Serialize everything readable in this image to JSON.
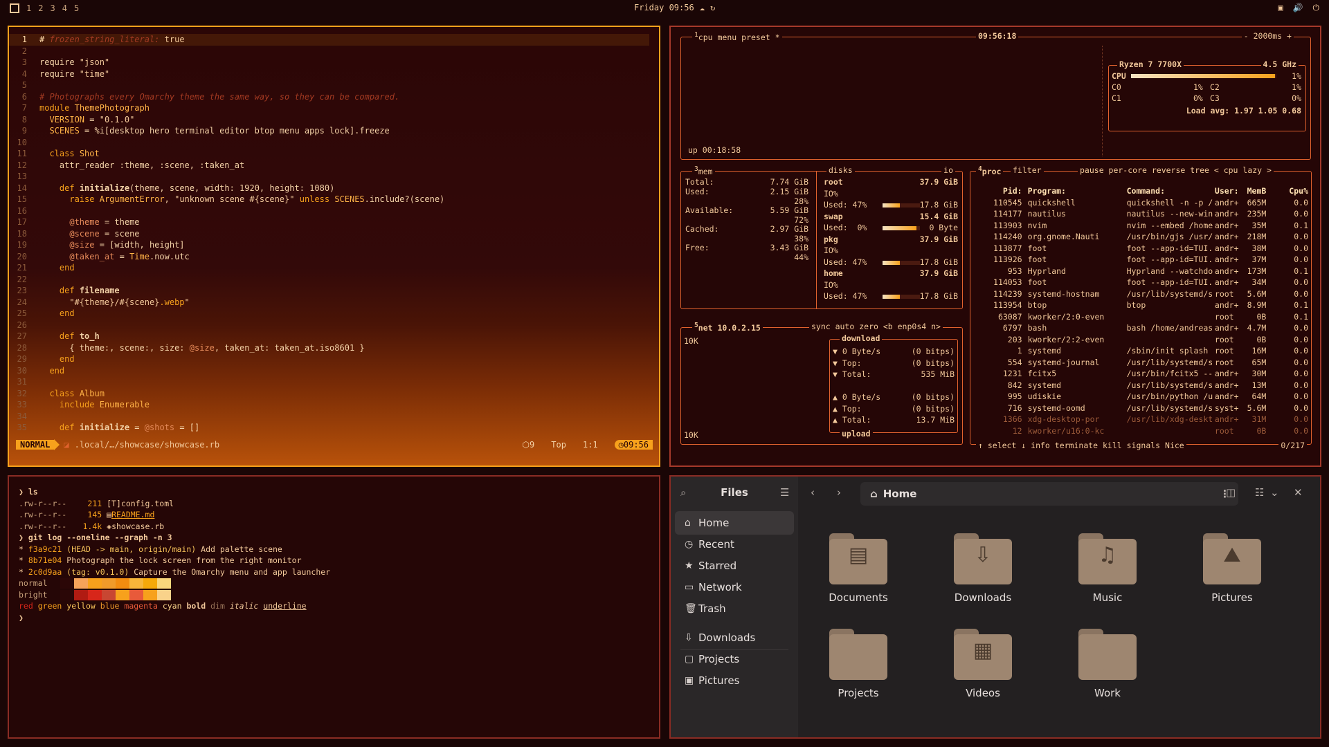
{
  "topbar": {
    "workspaces": [
      "1",
      "2",
      "3",
      "4",
      "5"
    ],
    "clock": "Friday 09:56"
  },
  "editor": {
    "lines": [
      {
        "n": "1",
        "html": "<span style='color:#ffd9a8'>#</span> <span class='cm'>frozen_string_literal:</span> <span class='str'>true</span>",
        "cur": true
      },
      {
        "n": "2",
        "html": ""
      },
      {
        "n": "3",
        "html": "require <span class='str'>\"json\"</span>"
      },
      {
        "n": "4",
        "html": "require <span class='str'>\"time\"</span>"
      },
      {
        "n": "5",
        "html": ""
      },
      {
        "n": "6",
        "html": "<span class='cm'># Photographs every Omarchy theme the same way, so they can be compared.</span>"
      },
      {
        "n": "7",
        "html": "<span class='kw'>module</span> <span class='cn'>ThemePhotograph</span>"
      },
      {
        "n": "8",
        "html": "  <span class='cn'>VERSION</span> = <span class='str'>\"0.1.0\"</span>"
      },
      {
        "n": "9",
        "html": "  <span class='cn'>SCENES</span> = %i[desktop hero terminal editor btop menu apps lock].freeze"
      },
      {
        "n": "10",
        "html": ""
      },
      {
        "n": "11",
        "html": "  <span class='kw'>class</span> <span class='cn'>Shot</span>"
      },
      {
        "n": "12",
        "html": "    attr_reader :theme, :scene, :taken_at"
      },
      {
        "n": "13",
        "html": ""
      },
      {
        "n": "14",
        "html": "    <span class='kw'>def</span> <b>initialize</b>(theme, scene, width: 1920, height: 1080)"
      },
      {
        "n": "15",
        "html": "      <span class='kw'>raise</span> <span class='cn'>ArgumentError</span>, <span class='str'>\"unknown scene #{scene}\"</span> <span class='kw'>unless</span> <span class='cn'>SCENES</span>.include?(scene)"
      },
      {
        "n": "16",
        "html": ""
      },
      {
        "n": "17",
        "html": "      <span class='ivar'>@theme</span> = theme"
      },
      {
        "n": "18",
        "html": "      <span class='ivar'>@scene</span> = scene"
      },
      {
        "n": "19",
        "html": "      <span class='ivar'>@size</span> = [width, height]"
      },
      {
        "n": "20",
        "html": "      <span class='ivar'>@taken_at</span> = <span class='cn'>Time</span>.now.utc"
      },
      {
        "n": "21",
        "html": "    <span class='kw'>end</span>"
      },
      {
        "n": "22",
        "html": ""
      },
      {
        "n": "23",
        "html": "    <span class='kw'>def</span> <b>filename</b>"
      },
      {
        "n": "24",
        "html": "      <span class='str'>\"#{theme}/#{scene}</span><span class='kw'>.webp</span><span class='str'>\"</span>"
      },
      {
        "n": "25",
        "html": "    <span class='kw'>end</span>"
      },
      {
        "n": "26",
        "html": ""
      },
      {
        "n": "27",
        "html": "    <span class='kw'>def</span> <b>to_h</b>"
      },
      {
        "n": "28",
        "html": "      { theme:, scene:, size: <span class='ivar'>@size</span>, taken_at: taken_at.iso8601 }"
      },
      {
        "n": "29",
        "html": "    <span class='kw'>end</span>"
      },
      {
        "n": "30",
        "html": "  <span class='kw'>end</span>"
      },
      {
        "n": "31",
        "html": ""
      },
      {
        "n": "32",
        "html": "  <span class='kw'>class</span> <span class='cn'>Album</span>"
      },
      {
        "n": "33",
        "html": "    <span class='kw'>include</span> <span class='cn'>Enumerable</span>"
      },
      {
        "n": "34",
        "html": ""
      },
      {
        "n": "35",
        "html": "    <span class='kw'>def</span> <b>initialize</b> = <span class='ivar'>@shots</span> = []"
      }
    ],
    "status": {
      "mode": "NORMAL",
      "path": ".local/…/showcase/showcase.rb",
      "lsp": "9",
      "pos": "Top",
      "cursor": "1:1",
      "time": "09:56"
    }
  },
  "btop": {
    "cpu": {
      "title_cpu": "cpu",
      "title_menu": "menu",
      "title_preset": "preset *",
      "clock": "09:56:18",
      "interval": "- 2000ms +",
      "uptime": "up 00:18:58",
      "model": "Ryzen 7 7700X",
      "freq": "4.5 GHz",
      "total_label": "CPU",
      "total_pct": "1%",
      "total_fill": 0.99,
      "cores": [
        {
          "name": "C0",
          "pct": "1%"
        },
        {
          "name": "C2",
          "pct": "1%"
        },
        {
          "name": "C1",
          "pct": "0%"
        },
        {
          "name": "C3",
          "pct": "0%"
        }
      ],
      "load": "Load avg: 1.97 1.05 0.68"
    },
    "mem": {
      "title": "mem",
      "rows": [
        {
          "label": "Total:",
          "value": "7.74 GiB"
        },
        {
          "label": "Used:",
          "value": "2.15 GiB",
          "pct": "28%"
        },
        {
          "label": "Available:",
          "value": "5.59 GiB",
          "pct": "72%"
        },
        {
          "label": "Cached:",
          "value": "2.97 GiB",
          "pct": "38%"
        },
        {
          "label": "Free:",
          "value": "3.43 GiB",
          "pct": "44%"
        }
      ]
    },
    "disks": {
      "title": "disks",
      "io_label": "io",
      "items": [
        {
          "name": "root",
          "size": "37.9 GiB",
          "io": "IO%",
          "used_label": "Used: 47%",
          "used": "17.8 GiB",
          "fill": 0.47
        },
        {
          "name": "swap",
          "size": "15.4 GiB",
          "io": "",
          "used_label": "Used:  0%",
          "used": "0 Byte",
          "fill": 0.9
        },
        {
          "name": "pkg",
          "size": "37.9 GiB",
          "io": "IO%",
          "used_label": "Used: 47%",
          "used": "17.8 GiB",
          "fill": 0.47
        },
        {
          "name": "home",
          "size": "37.9 GiB",
          "io": "IO%",
          "used_label": "Used: 47%",
          "used": "17.8 GiB",
          "fill": 0.47
        }
      ]
    },
    "net": {
      "title": "net",
      "ip": "10.0.2.15",
      "tags": "sync  auto  zero  <b enp0s4 n>",
      "scale_top": "10K",
      "scale_bottom": "10K",
      "download_label": "download",
      "upload_label": "upload",
      "down": [
        {
          "label": "▼ 0 Byte/s",
          "value": "(0 bitps)"
        },
        {
          "label": "▼ Top:",
          "value": "(0 bitps)"
        },
        {
          "label": "▼ Total:",
          "value": "535 MiB"
        }
      ],
      "up": [
        {
          "label": "▲ 0 Byte/s",
          "value": "(0 bitps)"
        },
        {
          "label": "▲ Top:",
          "value": "(0 bitps)"
        },
        {
          "label": "▲ Total:",
          "value": "13.7 MiB"
        }
      ]
    },
    "proc": {
      "title": "proc",
      "filter": "filter",
      "options": "pause  per-core  reverse  tree  < cpu lazy >",
      "headers": [
        "Pid:",
        "Program:",
        "Command:",
        "User:",
        "MemB",
        "Cpu%"
      ],
      "rows": [
        [
          "110545",
          "quickshell",
          "quickshell -n -p /",
          "andr+",
          "665M",
          "0.0"
        ],
        [
          "114177",
          "nautilus",
          "nautilus --new-win",
          "andr+",
          "235M",
          "0.0"
        ],
        [
          "113903",
          "nvim",
          "nvim --embed /home",
          "andr+",
          "35M",
          "0.1"
        ],
        [
          "114240",
          "org.gnome.Nauti",
          "/usr/bin/gjs /usr/",
          "andr+",
          "218M",
          "0.0"
        ],
        [
          "113877",
          "foot",
          "foot --app-id=TUI.",
          "andr+",
          "38M",
          "0.0"
        ],
        [
          "113926",
          "foot",
          "foot --app-id=TUI.",
          "andr+",
          "37M",
          "0.0"
        ],
        [
          "953",
          "Hyprland",
          "Hyprland --watchdo",
          "andr+",
          "173M",
          "0.1"
        ],
        [
          "114053",
          "foot",
          "foot --app-id=TUI.",
          "andr+",
          "34M",
          "0.0"
        ],
        [
          "114239",
          "systemd-hostnam",
          "/usr/lib/systemd/s",
          "root",
          "5.6M",
          "0.0"
        ],
        [
          "113954",
          "btop",
          "btop",
          "andr+",
          "8.9M",
          "0.1"
        ],
        [
          "63087",
          "kworker/2:0-even",
          "",
          "root",
          "0B",
          "0.1"
        ],
        [
          "6797",
          "bash",
          "bash /home/andreas",
          "andr+",
          "4.7M",
          "0.0"
        ],
        [
          "203",
          "kworker/2:2-even",
          "",
          "root",
          "0B",
          "0.0"
        ],
        [
          "1",
          "systemd",
          "/sbin/init splash",
          "root",
          "16M",
          "0.0"
        ],
        [
          "554",
          "systemd-journal",
          "/usr/lib/systemd/s",
          "root",
          "65M",
          "0.0"
        ],
        [
          "1231",
          "fcitx5",
          "/usr/bin/fcitx5 --",
          "andr+",
          "30M",
          "0.0"
        ],
        [
          "842",
          "systemd",
          "/usr/lib/systemd/s",
          "andr+",
          "13M",
          "0.0"
        ],
        [
          "995",
          "udiskie",
          "/usr/bin/python /u",
          "andr+",
          "64M",
          "0.0"
        ],
        [
          "716",
          "systemd-oomd",
          "/usr/lib/systemd/s",
          "syst+",
          "5.6M",
          "0.0"
        ],
        [
          "1366",
          "xdg-desktop-por",
          "/usr/lib/xdg-deskt",
          "andr+",
          "31M",
          "0.0"
        ],
        [
          "12",
          "kworker/u16:0-kc",
          "",
          "root",
          "0B",
          "0.0"
        ]
      ],
      "footer": "↑ select ↓  info  terminate  kill  signals  Nice",
      "count": "0/217"
    }
  },
  "terminal": {
    "prompt1": "❯ ls",
    "files": [
      {
        "perm": ".rw-r--r--",
        "size": "211",
        "icon": "[T]",
        "name": "config.toml",
        "u": false
      },
      {
        "perm": ".rw-r--r--",
        "size": "145",
        "icon": "▤",
        "name": "README.md",
        "u": true
      },
      {
        "perm": ".rw-r--r--",
        "size": "1.4k",
        "icon": "◈",
        "name": "showcase.rb",
        "u": false
      }
    ],
    "prompt2": "❯ git log --oneline --graph -n 3",
    "commits": [
      {
        "hash": "f3a9c21",
        "ref": "(HEAD -> main, origin/main)",
        "msg": "Add palette scene"
      },
      {
        "hash": "8b71e04",
        "ref": "",
        "msg": "Photograph the lock screen from the right monitor"
      },
      {
        "hash": "2c0d9aa",
        "ref": "(tag: v0.1.0)",
        "msg": "Capture the Omarchy menu and app launcher"
      }
    ],
    "normal_label": "normal",
    "bright_label": "bright",
    "normal_colors": [
      "#2b0707",
      "#f6a35a",
      "#f7a11c",
      "#f09b2a",
      "#f28c10",
      "#f7b63a",
      "#f6a90a",
      "#f9d77c"
    ],
    "bright_colors": [
      "#2b0707",
      "#b01b12",
      "#d7261a",
      "#c84632",
      "#f7a11c",
      "#e85a3a",
      "#f7a11c",
      "#f9d28a"
    ],
    "styles": [
      "red",
      "green",
      "yellow",
      "blue",
      "magenta",
      "cyan",
      "bold",
      "dim",
      "italic",
      "underline"
    ],
    "prompt3": "❯"
  },
  "files": {
    "title": "Files",
    "location": "Home",
    "sidebar": [
      {
        "label": "Home",
        "icon": "⌂",
        "active": true
      },
      {
        "label": "Recent",
        "icon": "◷"
      },
      {
        "label": "Starred",
        "icon": "★"
      },
      {
        "label": "Network",
        "icon": "▭"
      },
      {
        "label": "Trash",
        "icon": "🗑"
      },
      {
        "label": "Downloads",
        "icon": "⇩"
      },
      {
        "label": "Projects",
        "icon": "▢"
      },
      {
        "label": "Pictures",
        "icon": "▣"
      }
    ],
    "folders": [
      {
        "label": "Documents",
        "sym": "▤"
      },
      {
        "label": "Downloads",
        "sym": "⇩"
      },
      {
        "label": "Music",
        "sym": "♫"
      },
      {
        "label": "Pictures",
        "sym": "⛰"
      },
      {
        "label": "Projects",
        "sym": ""
      },
      {
        "label": "Videos",
        "sym": "▦"
      },
      {
        "label": "Work",
        "sym": ""
      }
    ]
  }
}
